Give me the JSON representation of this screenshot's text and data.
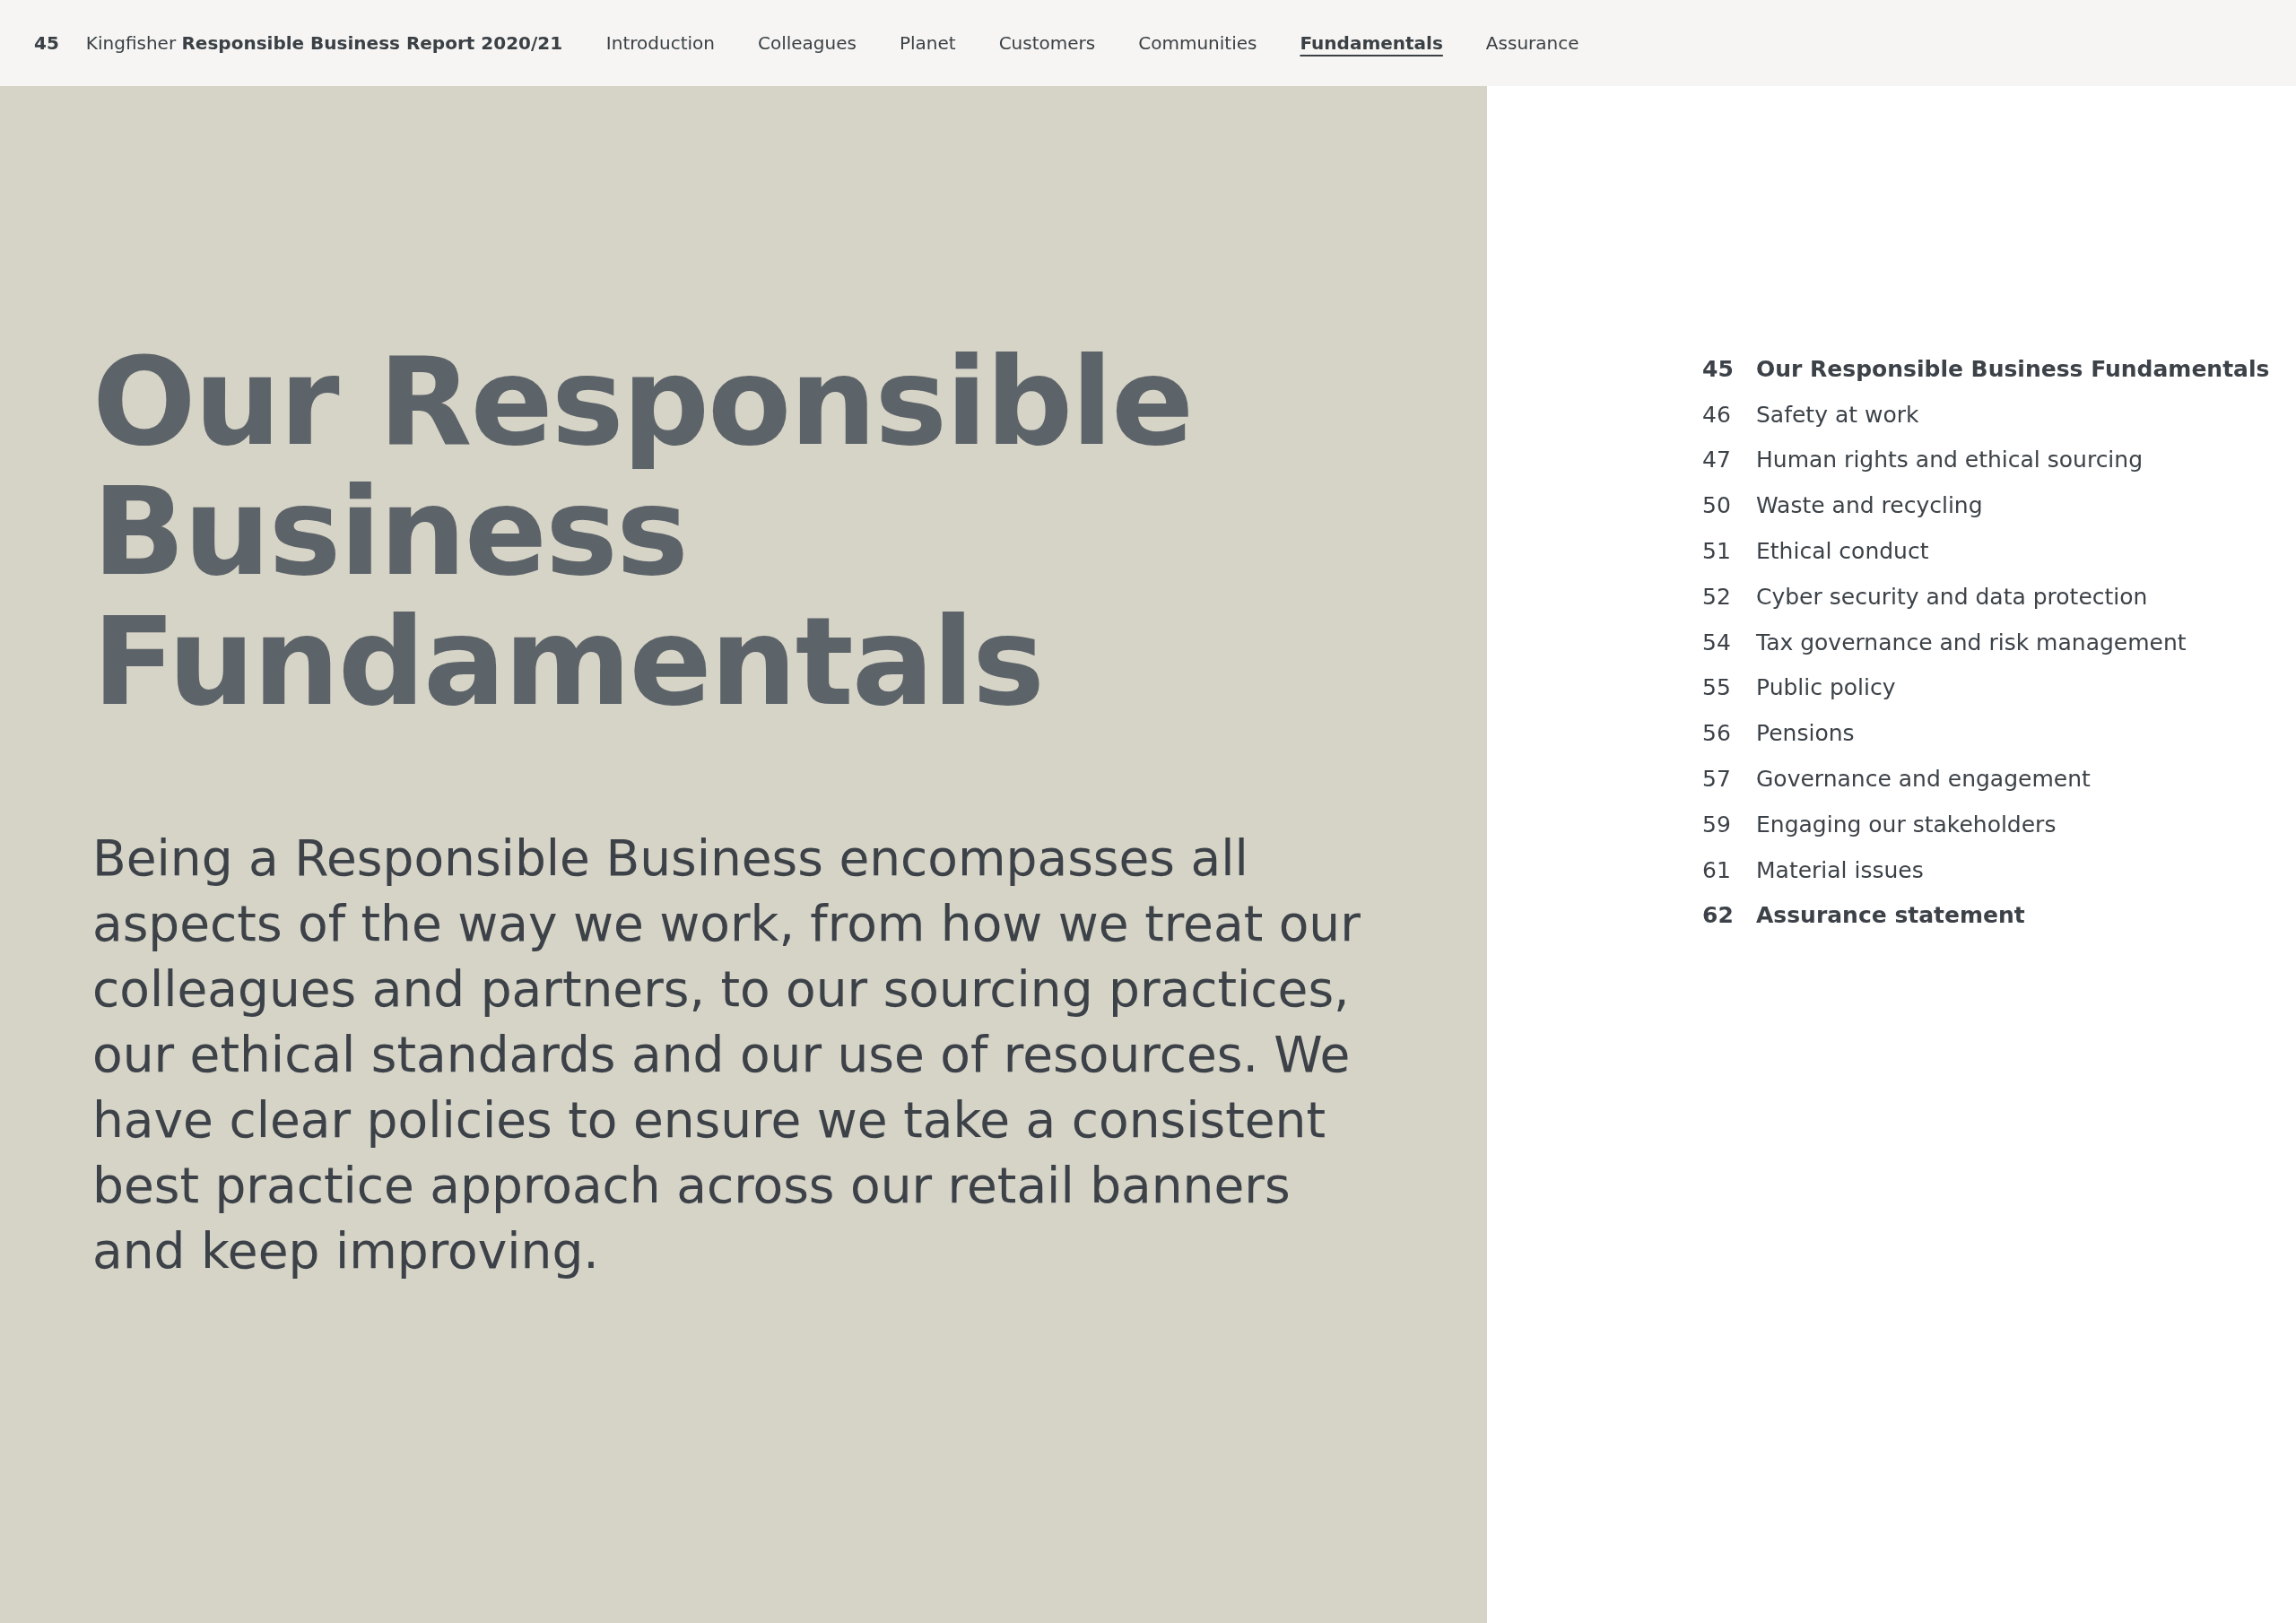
{
  "header": {
    "page_number": "45",
    "report_title": "Kingfisher **Responsible Business Report 2020/21**",
    "nav": [
      {
        "label": "Introduction",
        "selected": false
      },
      {
        "label": "Colleagues",
        "selected": false
      },
      {
        "label": "Planet",
        "selected": false
      },
      {
        "label": "Customers",
        "selected": false
      },
      {
        "label": "Communities",
        "selected": false
      },
      {
        "label": "Fundamentals",
        "selected": true
      },
      {
        "label": "Assurance",
        "selected": false
      }
    ]
  },
  "hero": {
    "title": "Our Responsible Business Fundamentals",
    "intro": "Being a Responsible Business encompasses all aspects of the way we work, from how we treat our colleagues and partners, to our sourcing practices, our ethical standards and our use of resources. We have clear policies to ensure we take a consistent best practice approach across our retail banners and keep improving."
  },
  "contents": [
    {
      "page": "45",
      "title": "Our Responsible Business Fundamentals",
      "bold": true
    },
    {
      "page": "46",
      "title": "Safety at work",
      "bold": false
    },
    {
      "page": "47",
      "title": "Human rights and ethical sourcing",
      "bold": false
    },
    {
      "page": "50",
      "title": "Waste and recycling",
      "bold": false
    },
    {
      "page": "51",
      "title": "Ethical conduct",
      "bold": false
    },
    {
      "page": "52",
      "title": "Cyber security and data protection",
      "bold": false
    },
    {
      "page": "54",
      "title": "Tax governance and risk management",
      "bold": false
    },
    {
      "page": "55",
      "title": "Public policy",
      "bold": false
    },
    {
      "page": "56",
      "title": "Pensions",
      "bold": false
    },
    {
      "page": "57",
      "title": "Governance and engagement",
      "bold": false
    },
    {
      "page": "59",
      "title": "Engaging our stakeholders",
      "bold": false
    },
    {
      "page": "61",
      "title": "Material issues",
      "bold": false
    },
    {
      "page": "62",
      "title": "Assurance statement",
      "bold": true
    }
  ]
}
